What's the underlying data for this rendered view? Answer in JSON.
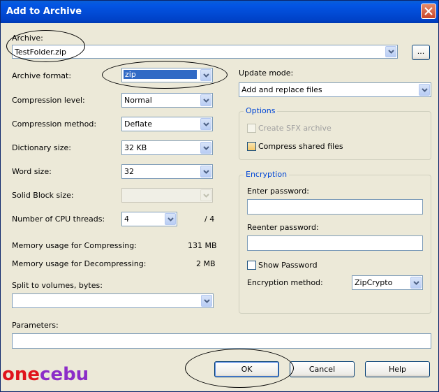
{
  "window": {
    "title": "Add to Archive"
  },
  "archive": {
    "label": "Archive:",
    "value": "TestFolder.zip",
    "browse_label": "..."
  },
  "fields": {
    "format": {
      "label": "Archive format:",
      "value": "zip"
    },
    "level": {
      "label": "Compression level:",
      "value": "Normal"
    },
    "method": {
      "label": "Compression method:",
      "value": "Deflate"
    },
    "dict": {
      "label": "Dictionary size:",
      "value": "32 KB"
    },
    "word": {
      "label": "Word size:",
      "value": "32"
    },
    "solid": {
      "label": "Solid Block size:",
      "value": ""
    },
    "cpu": {
      "label": "Number of CPU threads:",
      "value": "4",
      "max": "/ 4"
    }
  },
  "memory": {
    "compress_label": "Memory usage for Compressing:",
    "compress_value": "131 MB",
    "decompress_label": "Memory usage for Decompressing:",
    "decompress_value": "2 MB"
  },
  "split": {
    "label": "Split to volumes, bytes:",
    "value": ""
  },
  "parameters": {
    "label": "Parameters:",
    "value": ""
  },
  "update": {
    "label": "Update mode:",
    "value": "Add and replace files"
  },
  "options": {
    "legend": "Options",
    "sfx_label": "Create SFX archive",
    "shared_label": "Compress shared files"
  },
  "encryption": {
    "legend": "Encryption",
    "enter_label": "Enter password:",
    "reenter_label": "Reenter password:",
    "show_label": "Show Password",
    "method_label": "Encryption method:",
    "method_value": "ZipCrypto"
  },
  "buttons": {
    "ok": "OK",
    "cancel": "Cancel",
    "help": "Help"
  },
  "watermark": {
    "part1": "one",
    "part2": "c",
    "part3": "ebu"
  },
  "colors": {
    "titlebar": "#0355E4",
    "face": "#ECE9D8",
    "selection": "#316AC5"
  }
}
